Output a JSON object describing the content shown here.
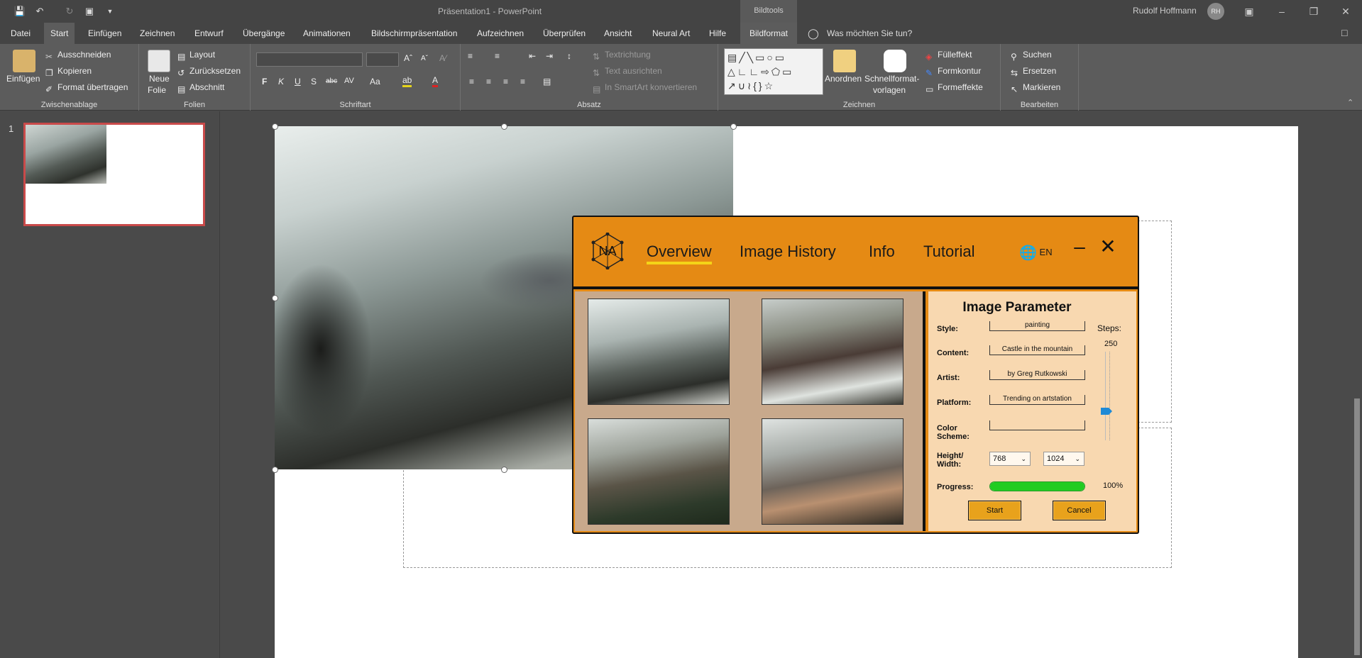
{
  "titlebar": {
    "title": "Präsentation1  -  PowerPoint",
    "context_group": "Bildtools",
    "user_name": "Rudolf Hoffmann",
    "user_initials": "RH"
  },
  "tabs": [
    "Datei",
    "Start",
    "Einfügen",
    "Zeichnen",
    "Entwurf",
    "Übergänge",
    "Animationen",
    "Bildschirmpräsentation",
    "Aufzeichnen",
    "Überprüfen",
    "Ansicht",
    "Neural Art",
    "Hilfe",
    "Bildformat"
  ],
  "active_tab": "Start",
  "tell_me": "Was möchten Sie tun?",
  "ribbon": {
    "clipboard": {
      "label": "Zwischenablage",
      "paste": "Einfügen",
      "cut": "Ausschneiden",
      "copy": "Kopieren",
      "format_painter": "Format übertragen"
    },
    "slides": {
      "label": "Folien",
      "new_slide_1": "Neue",
      "new_slide_2": "Folie",
      "layout": "Layout",
      "reset": "Zurücksetzen",
      "section": "Abschnitt"
    },
    "font": {
      "label": "Schriftart",
      "bold": "F",
      "italic": "K",
      "underline": "U",
      "shadow": "S",
      "strike": "abc",
      "spacing": "AV",
      "case": "Aa"
    },
    "paragraph": {
      "label": "Absatz",
      "text_direction": "Textrichtung",
      "align_text": "Text ausrichten",
      "smartart": "In SmartArt konvertieren"
    },
    "drawing": {
      "label": "Zeichnen",
      "arrange": "Anordnen",
      "quick_styles_1": "Schnellformat-",
      "quick_styles_2": "vorlagen",
      "fill": "Fülleffekt",
      "outline": "Formkontur",
      "effects": "Formeffekte"
    },
    "editing": {
      "label": "Bearbeiten",
      "find": "Suchen",
      "replace": "Ersetzen",
      "select": "Markieren"
    }
  },
  "slide_pane": {
    "slide_number": "1"
  },
  "plugin": {
    "logo": "NA",
    "tabs": [
      "Overview",
      "Image History",
      "Info",
      "Tutorial"
    ],
    "active_tab": "Overview",
    "language": "EN",
    "params": {
      "title": "Image Parameter",
      "style_label": "Style:",
      "style": "painting",
      "content_label": "Content:",
      "content": "Castle in the mountain",
      "artist_label": "Artist:",
      "artist": "by Greg Rutkowski",
      "platform_label": "Platform:",
      "platform": "Trending on artstation",
      "color_label_1": "Color",
      "color_label_2": "Scheme:",
      "color_scheme": "",
      "size_label_1": "Height/",
      "size_label_2": "Width:",
      "height": "768",
      "width": "1024",
      "steps_label": "Steps:",
      "steps": "250",
      "progress_label": "Progress:",
      "progress": 1.0,
      "progress_text": "100%",
      "start": "Start",
      "cancel": "Cancel"
    }
  },
  "colors": {
    "accent": "#e58a14",
    "progress": "#21cc21",
    "selection": "#c94a4a"
  }
}
